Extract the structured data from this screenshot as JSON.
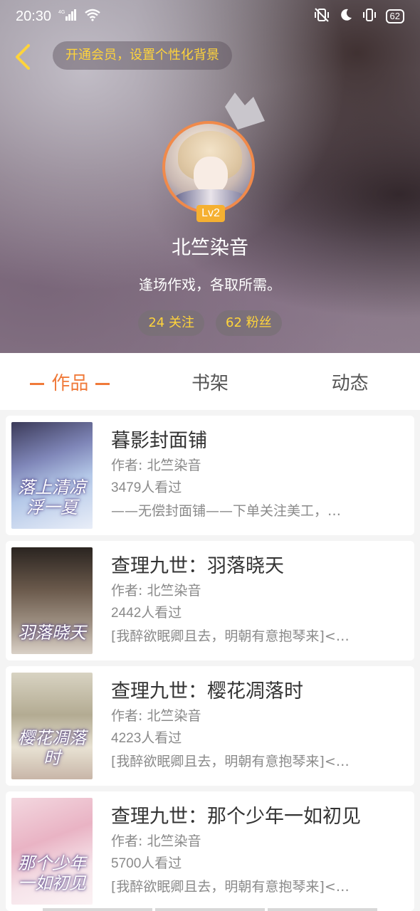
{
  "status_bar": {
    "time": "20:30",
    "network": "4G",
    "battery": "62"
  },
  "header": {
    "vip_banner": "开通会员，设置个性化背景",
    "level": "Lv2",
    "user_name": "北竺染音",
    "signature": "逢场作戏，各取所需。",
    "following": "24 关注",
    "followers": "62 粉丝",
    "accent_color": "#f08a4b",
    "highlight_color": "#ffd43b"
  },
  "tabs": [
    {
      "label": "作品",
      "active": true
    },
    {
      "label": "书架",
      "active": false
    },
    {
      "label": "动态",
      "active": false
    }
  ],
  "works": [
    {
      "cover_text": "落上清凉浮一夏",
      "title": "暮影封面铺",
      "author": "作者: 北竺染音",
      "views": "3479人看过",
      "desc": "——无偿封面铺——下单关注美工，…"
    },
    {
      "cover_text": "羽落晓天",
      "title": "查理九世：羽落晓天",
      "author": "作者: 北竺染音",
      "views": "2442人看过",
      "desc": "[我醉欲眠卿且去，明朝有意抱琴来]<…"
    },
    {
      "cover_text": "樱花凋落时",
      "title": "查理九世：樱花凋落时",
      "author": "作者: 北竺染音",
      "views": "4223人看过",
      "desc": "[我醉欲眠卿且去，明朝有意抱琴来]<…"
    },
    {
      "cover_text": "那个少年一如初见",
      "title": "查理九世：那个少年一如初见",
      "author": "作者: 北竺染音",
      "views": "5700人看过",
      "desc": "[我醉欲眠卿且去，明朝有意抱琴来]<…"
    }
  ]
}
